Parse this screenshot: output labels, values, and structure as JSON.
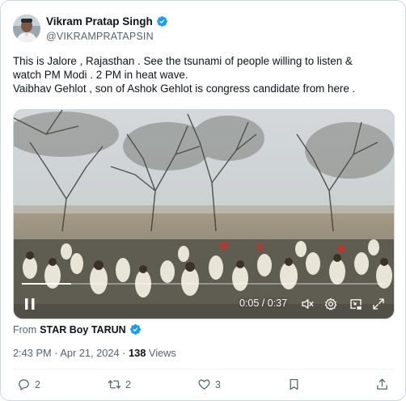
{
  "author": {
    "name": "Vikram Pratap Singh",
    "handle": "@VIKRAMPRATAPSIN"
  },
  "tweet": {
    "lines": [
      "This is Jalore , Rajasthan . See the tsunami of people willing to listen &",
      "watch PM Modi . 2 PM in heat wave.",
      "Vaibhav Gehlot , son of Ashok Gehlot is congress candidate from here ."
    ]
  },
  "video": {
    "time_display": "0:05 / 0:37",
    "progress": 0.135
  },
  "source": {
    "label": "From",
    "name": "STAR Boy TARUN"
  },
  "meta": {
    "timestamp": "2:43 PM · Apr 21, 2024 · ",
    "views_count": "138",
    "views_label": " Views"
  },
  "actions": {
    "replies": "2",
    "retweets": "2",
    "likes": "3"
  },
  "colors": {
    "verified_blue": "#1d9bf0",
    "text_primary": "#0f1419",
    "text_secondary": "#536471"
  },
  "icons": [
    "verified-badge-icon",
    "play-pause-icon",
    "mute-icon",
    "settings-icon",
    "pip-icon",
    "fullscreen-icon",
    "reply-icon",
    "retweet-icon",
    "like-icon",
    "bookmark-icon",
    "share-icon"
  ]
}
